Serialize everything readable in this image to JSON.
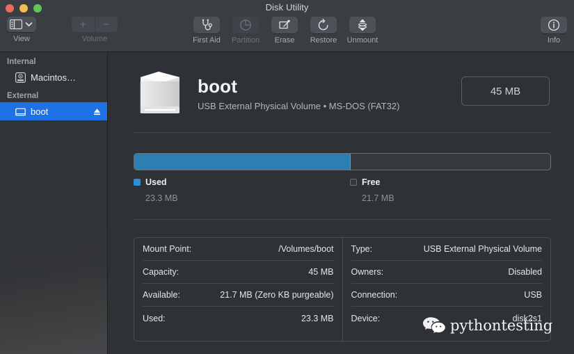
{
  "window": {
    "title": "Disk Utility",
    "traffic_lights": [
      "close",
      "minimize",
      "zoom"
    ]
  },
  "toolbar": {
    "view": {
      "label": "View",
      "icon": "sidebar-layout-icon",
      "chevron": "chevron-down-icon"
    },
    "volume": {
      "label": "Volume",
      "add": "+",
      "remove": "−",
      "disabled": true
    },
    "tools": [
      {
        "label": "First Aid",
        "icon": "stethoscope-icon",
        "disabled": false
      },
      {
        "label": "Partition",
        "icon": "pie-chart-icon",
        "disabled": true
      },
      {
        "label": "Erase",
        "icon": "erase-icon",
        "disabled": false
      },
      {
        "label": "Restore",
        "icon": "restore-icon",
        "disabled": false
      },
      {
        "label": "Unmount",
        "icon": "unmount-icon",
        "disabled": false
      }
    ],
    "info": {
      "label": "Info",
      "icon": "info-circle-icon"
    }
  },
  "sidebar": {
    "groups": [
      {
        "header": "Internal",
        "items": [
          {
            "name": "Macintos…",
            "icon": "internal-disk-icon",
            "selected": false,
            "eject": false
          }
        ]
      },
      {
        "header": "External",
        "items": [
          {
            "name": "boot",
            "icon": "external-volume-icon",
            "selected": true,
            "eject": true,
            "eject_icon": "eject-icon"
          }
        ]
      }
    ]
  },
  "main": {
    "volume_icon": "hard-drive-icon",
    "title": "boot",
    "subtitle": "USB External Physical Volume • MS-DOS (FAT32)",
    "capacity_badge": "45 MB",
    "usage_bar": {
      "used_percent": 52,
      "used_color": "#2b7fb3",
      "free_color": "#35383d"
    },
    "legend": [
      {
        "name": "Used",
        "value": "23.3 MB",
        "swatch": "used"
      },
      {
        "name": "Free",
        "value": "21.7 MB",
        "swatch": "free"
      }
    ],
    "details": {
      "left": [
        {
          "key": "Mount Point:",
          "value": "/Volumes/boot"
        },
        {
          "key": "Capacity:",
          "value": "45 MB"
        },
        {
          "key": "Available:",
          "value": "21.7 MB (Zero KB purgeable)"
        },
        {
          "key": "Used:",
          "value": "23.3 MB"
        }
      ],
      "right": [
        {
          "key": "Type:",
          "value": "USB External Physical Volume"
        },
        {
          "key": "Owners:",
          "value": "Disabled"
        },
        {
          "key": "Connection:",
          "value": "USB"
        },
        {
          "key": "Device:",
          "value": "disk2s1"
        }
      ]
    }
  },
  "watermark": {
    "text": "pythontesting",
    "icon": "wechat-bubbles-icon"
  },
  "colors": {
    "accent_blue": "#1f72e5",
    "bar_blue": "#2b7fb3",
    "window_bg": "#2e3136",
    "titlebar_bg": "#3a3d42"
  }
}
